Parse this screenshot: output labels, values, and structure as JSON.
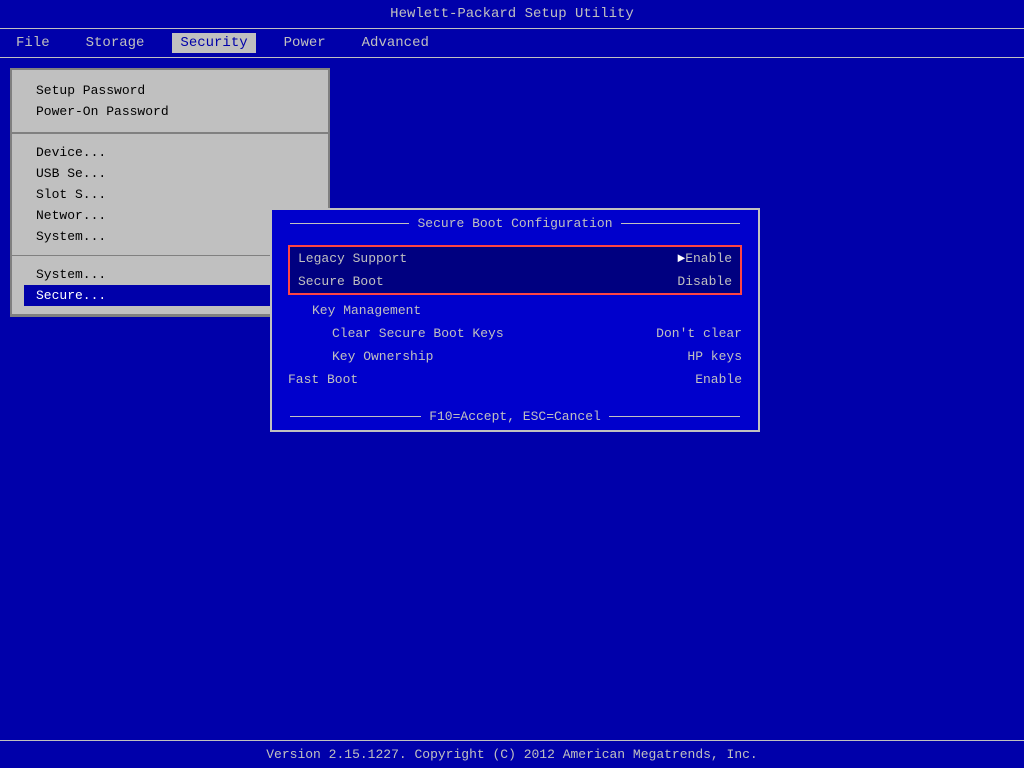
{
  "title_bar": {
    "label": "Hewlett-Packard Setup Utility"
  },
  "menu": {
    "items": [
      {
        "id": "file",
        "label": "File",
        "active": false
      },
      {
        "id": "storage",
        "label": "Storage",
        "active": false
      },
      {
        "id": "security",
        "label": "Security",
        "active": true
      },
      {
        "id": "power",
        "label": "Power",
        "active": false
      },
      {
        "id": "advanced",
        "label": "Advanced",
        "active": false
      }
    ]
  },
  "security_panel": {
    "top_items": [
      {
        "id": "setup-password",
        "label": "Setup Password",
        "selected": false
      },
      {
        "id": "power-on-password",
        "label": "Power-On Password",
        "selected": false
      }
    ],
    "bottom_items": [
      {
        "id": "device",
        "label": "Device...",
        "selected": false
      },
      {
        "id": "usb-security",
        "label": "USB Se...",
        "selected": false
      },
      {
        "id": "slot-security",
        "label": "Slot S...",
        "selected": false
      },
      {
        "id": "network",
        "label": "Networ...",
        "selected": false
      },
      {
        "id": "system-ids",
        "label": "System...",
        "selected": false
      }
    ],
    "lower_items": [
      {
        "id": "system-security",
        "label": "System...",
        "selected": false
      },
      {
        "id": "secure-boot",
        "label": "Secure...",
        "selected": true
      }
    ]
  },
  "secure_boot_dialog": {
    "title": "Secure Boot Configuration",
    "rows": [
      {
        "id": "legacy-support",
        "label": "Legacy Support",
        "value": "Enable",
        "highlighted": true,
        "sub": false,
        "arrow": true
      },
      {
        "id": "secure-boot",
        "label": "Secure Boot",
        "value": "Disable",
        "highlighted": true,
        "sub": false,
        "arrow": false
      },
      {
        "id": "key-management",
        "label": "Key Management",
        "value": "",
        "highlighted": false,
        "sub": true,
        "arrow": false
      },
      {
        "id": "clear-secure-boot-keys",
        "label": "Clear Secure Boot Keys",
        "value": "Don't clear",
        "highlighted": false,
        "sub": true,
        "sub_level": 2,
        "arrow": false
      },
      {
        "id": "key-ownership",
        "label": "Key Ownership",
        "value": "HP keys",
        "highlighted": false,
        "sub": true,
        "sub_level": 2,
        "arrow": false
      },
      {
        "id": "fast-boot",
        "label": "Fast Boot",
        "value": "Enable",
        "highlighted": false,
        "sub": false,
        "arrow": false
      }
    ],
    "footer": "F10=Accept, ESC=Cancel"
  },
  "status_bar": {
    "label": "Version 2.15.1227. Copyright (C) 2012 American Megatrends, Inc."
  }
}
